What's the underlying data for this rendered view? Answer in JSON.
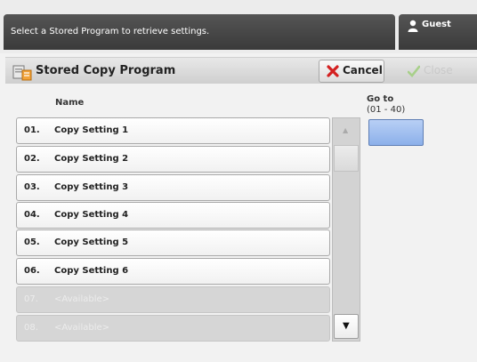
{
  "message": "Select a Stored Program to retrieve settings.",
  "user": {
    "name": "Guest",
    "icon": "user-icon"
  },
  "title": {
    "text": "Stored Copy Program",
    "icon": "stored-program-icon"
  },
  "buttons": {
    "cancel": "Cancel",
    "close": "Close"
  },
  "list": {
    "column_header": "Name",
    "rows": [
      {
        "num": "01.",
        "name": "Copy Setting 1",
        "available": false
      },
      {
        "num": "02.",
        "name": "Copy Setting 2",
        "available": false
      },
      {
        "num": "03.",
        "name": "Copy Setting 3",
        "available": false
      },
      {
        "num": "04.",
        "name": "Copy Setting 4",
        "available": false
      },
      {
        "num": "05.",
        "name": "Copy Setting 5",
        "available": false
      },
      {
        "num": "06.",
        "name": "Copy Setting 6",
        "available": false
      },
      {
        "num": "07.",
        "name": "<Available>",
        "available": true
      },
      {
        "num": "08.",
        "name": "<Available>",
        "available": true
      }
    ]
  },
  "goto": {
    "label": "Go to",
    "range": "(01 - 40)",
    "value": ""
  },
  "colors": {
    "header_dark": "#3a3a3a",
    "goto_blue": "#8cb0ea",
    "cancel_red": "#d42020",
    "close_green": "#a8d08a"
  }
}
